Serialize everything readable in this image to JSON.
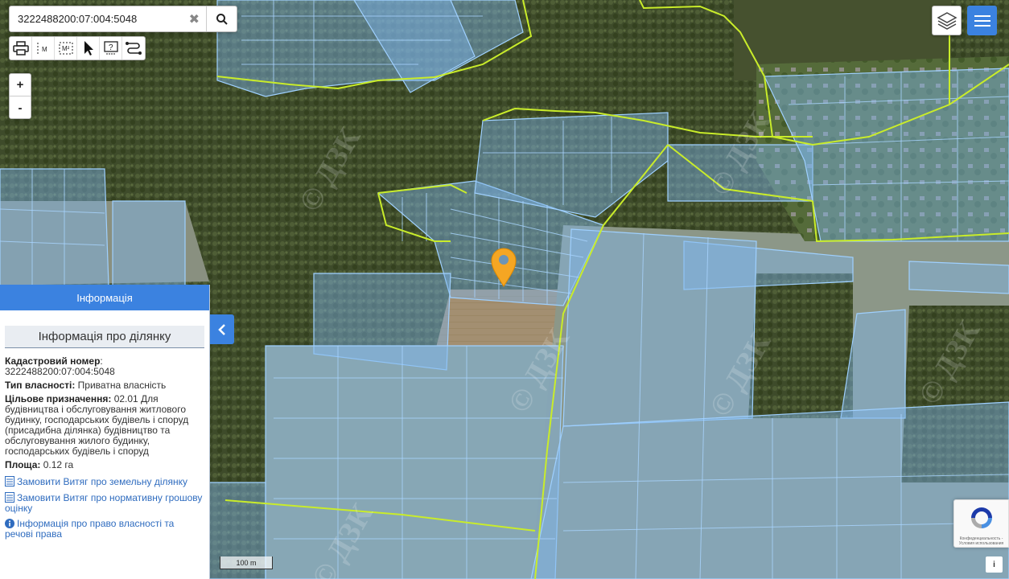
{
  "search": {
    "value": "3222488200:07:004:5048",
    "clear_icon": "close-icon",
    "search_icon": "magnifier-icon"
  },
  "toolbar": {
    "items": [
      {
        "name": "print-icon"
      },
      {
        "name": "measure-length-icon",
        "label": "M"
      },
      {
        "name": "measure-area-icon",
        "label": "M²"
      },
      {
        "name": "select-cursor-icon"
      },
      {
        "name": "help-icon",
        "label": "?"
      },
      {
        "name": "route-icon"
      }
    ]
  },
  "zoom": {
    "in_label": "+",
    "out_label": "-"
  },
  "colors": {
    "accent": "#3b82e0",
    "parcel_fill": "#7fb6ee",
    "parcel_stroke": "#9fd0ff",
    "boundary": "#c9ec2a",
    "marker": "#f5a623"
  },
  "info_panel": {
    "header": "Інформація",
    "section_title": "Інформація про ділянку",
    "cadastral_label": "Кадастровий номер",
    "cadastral_value": "3222488200:07:004:5048",
    "ownership_label": "Тип власності:",
    "ownership_value": "Приватна власність",
    "purpose_label": "Цільове призначення:",
    "purpose_value": "02.01 Для будівництва і обслуговування житлового будинку, господарських будівель і споруд (присадибна ділянка) будівництво та обслуговування жилого будинку, господарських будівель і споруд",
    "area_label": "Площа:",
    "area_value": "0.12 га",
    "links": [
      {
        "label": "Замовити Витяг про земельну ділянку",
        "icon": "document-icon"
      },
      {
        "label": "Замовити Витяг про нормативну грошову оцінку",
        "icon": "document-icon"
      },
      {
        "label": "Інформація про право власності та речові права",
        "icon": "info-circle-icon"
      }
    ]
  },
  "scale_label": "100 m",
  "map": {
    "watermark": "© ДЗК"
  },
  "recaptcha": {
    "text": "Конфиденциальность - Условия использования"
  },
  "attribution_button": "i"
}
